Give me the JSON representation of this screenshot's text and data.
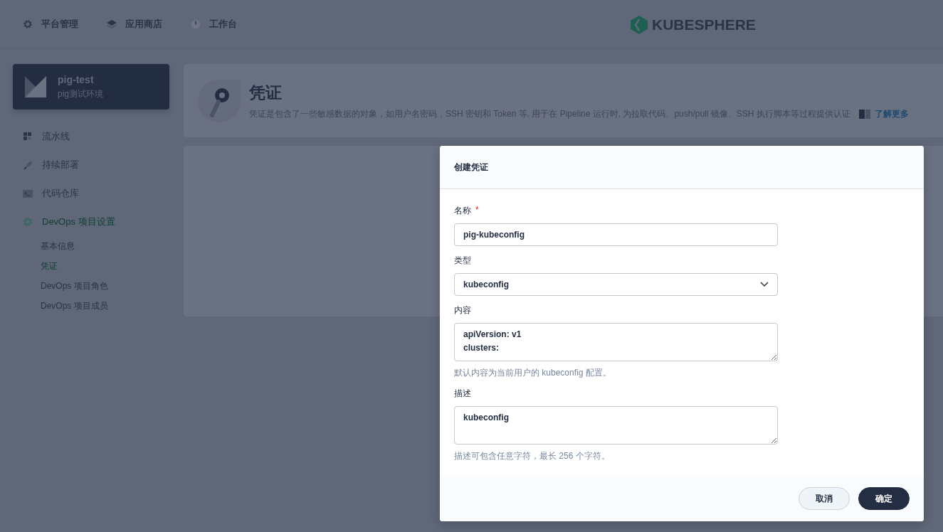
{
  "top_nav": [
    {
      "label": "平台管理"
    },
    {
      "label": "应用商店"
    },
    {
      "label": "工作台"
    }
  ],
  "logo": {
    "text": "KUBESPHERE"
  },
  "project": {
    "name": "pig-test",
    "description": "pig测试环境"
  },
  "sidebar": {
    "items": [
      {
        "label": "流水线",
        "selected": false
      },
      {
        "label": "持续部署",
        "selected": false
      },
      {
        "label": "代码仓库",
        "selected": false
      },
      {
        "label": "DevOps 项目设置",
        "selected": true,
        "children": [
          {
            "label": "基本信息",
            "selected": false
          },
          {
            "label": "凭证",
            "selected": true
          },
          {
            "label": "DevOps 项目角色",
            "selected": false
          },
          {
            "label": "DevOps 项目成员",
            "selected": false
          }
        ]
      }
    ]
  },
  "page_header": {
    "title": "凭证",
    "description": "凭证是包含了一些敏感数据的对象，如用户名密码，SSH 密钥和 Token 等, 用于在 Pipeline 运行时, 为拉取代码、push/pull 镜像、SSH 执行脚本等过程提供认证",
    "link": "了解更多"
  },
  "dialog": {
    "title": "创建凭证",
    "fields": [
      {
        "kind": "input",
        "label": "名称",
        "required_mark": "*",
        "value": "pig-kubeconfig"
      },
      {
        "kind": "select",
        "label": "类型",
        "value": "kubeconfig"
      },
      {
        "kind": "textarea",
        "label": "内容",
        "value": "apiVersion: v1\nclusters:",
        "hint": "默认内容为当前用户的 kubeconfig 配置。"
      },
      {
        "kind": "textarea",
        "label": "描述",
        "value": "kubeconfig",
        "hint": "描述可包含任意字符，最长 256 个字符。"
      }
    ],
    "buttons": [
      {
        "label": "取消",
        "kind": "secondary"
      },
      {
        "label": "确定",
        "kind": "primary"
      }
    ]
  }
}
